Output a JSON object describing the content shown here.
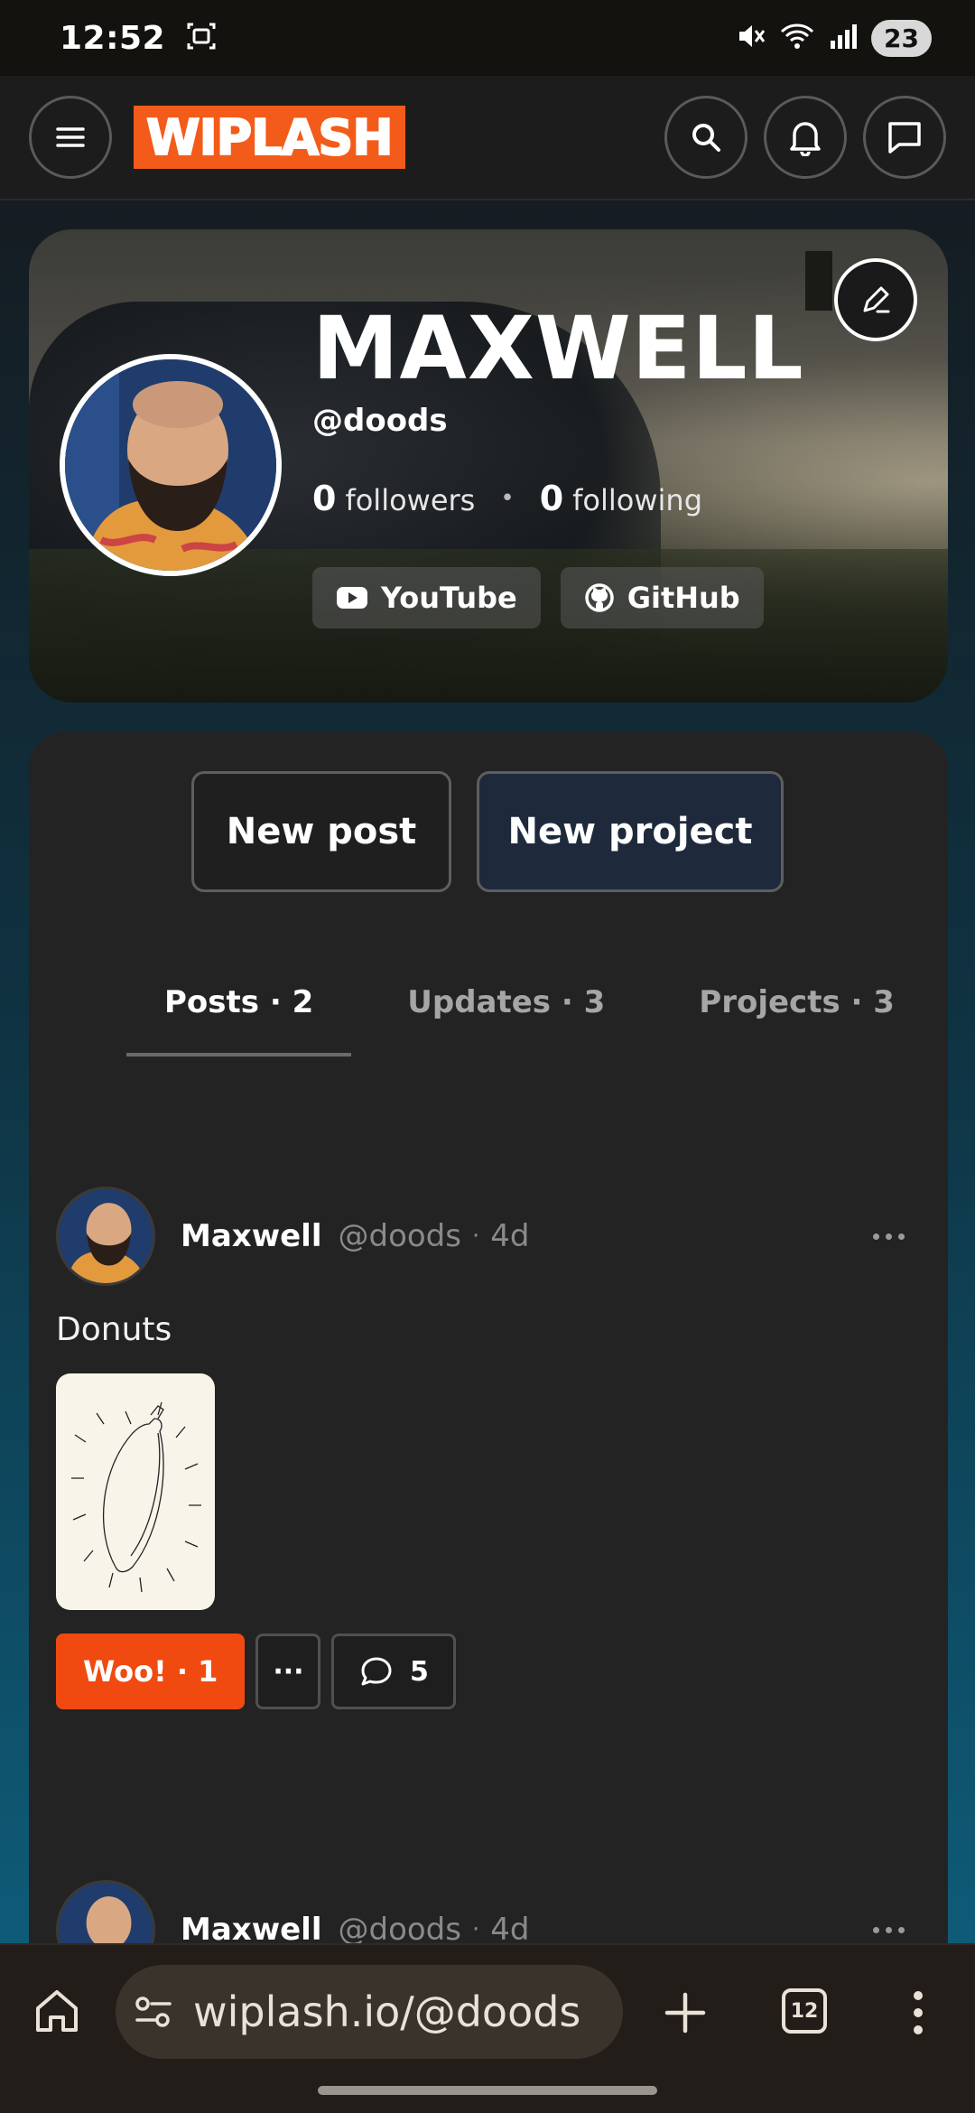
{
  "status_bar": {
    "time": "12:52",
    "battery": "23"
  },
  "header": {
    "logo_text": "WIPLASH",
    "brand_color": "#f35b1a"
  },
  "profile": {
    "name": "MAXWELL",
    "handle": "@doods",
    "followers_count": "0",
    "followers_label": "followers",
    "following_count": "0",
    "following_label": "following",
    "links": [
      {
        "label": "YouTube",
        "icon": "youtube-icon"
      },
      {
        "label": "GitHub",
        "icon": "github-icon"
      }
    ]
  },
  "actions": {
    "new_post": "New post",
    "new_project": "New project"
  },
  "tabs": [
    {
      "label": "Posts · 2",
      "active": true
    },
    {
      "label": "Updates · 3",
      "active": false
    },
    {
      "label": "Projects · 3",
      "active": false
    }
  ],
  "posts": [
    {
      "author": "Maxwell",
      "handle": "@doods",
      "time": "4d",
      "text": "Donuts",
      "woo_label": "Woo! · 1",
      "more_label": "···",
      "comments": "5"
    },
    {
      "author": "Maxwell",
      "handle": "@doods",
      "time": "4d"
    }
  ],
  "browser": {
    "url": "wiplash.io/@doods",
    "tab_count": "12"
  }
}
